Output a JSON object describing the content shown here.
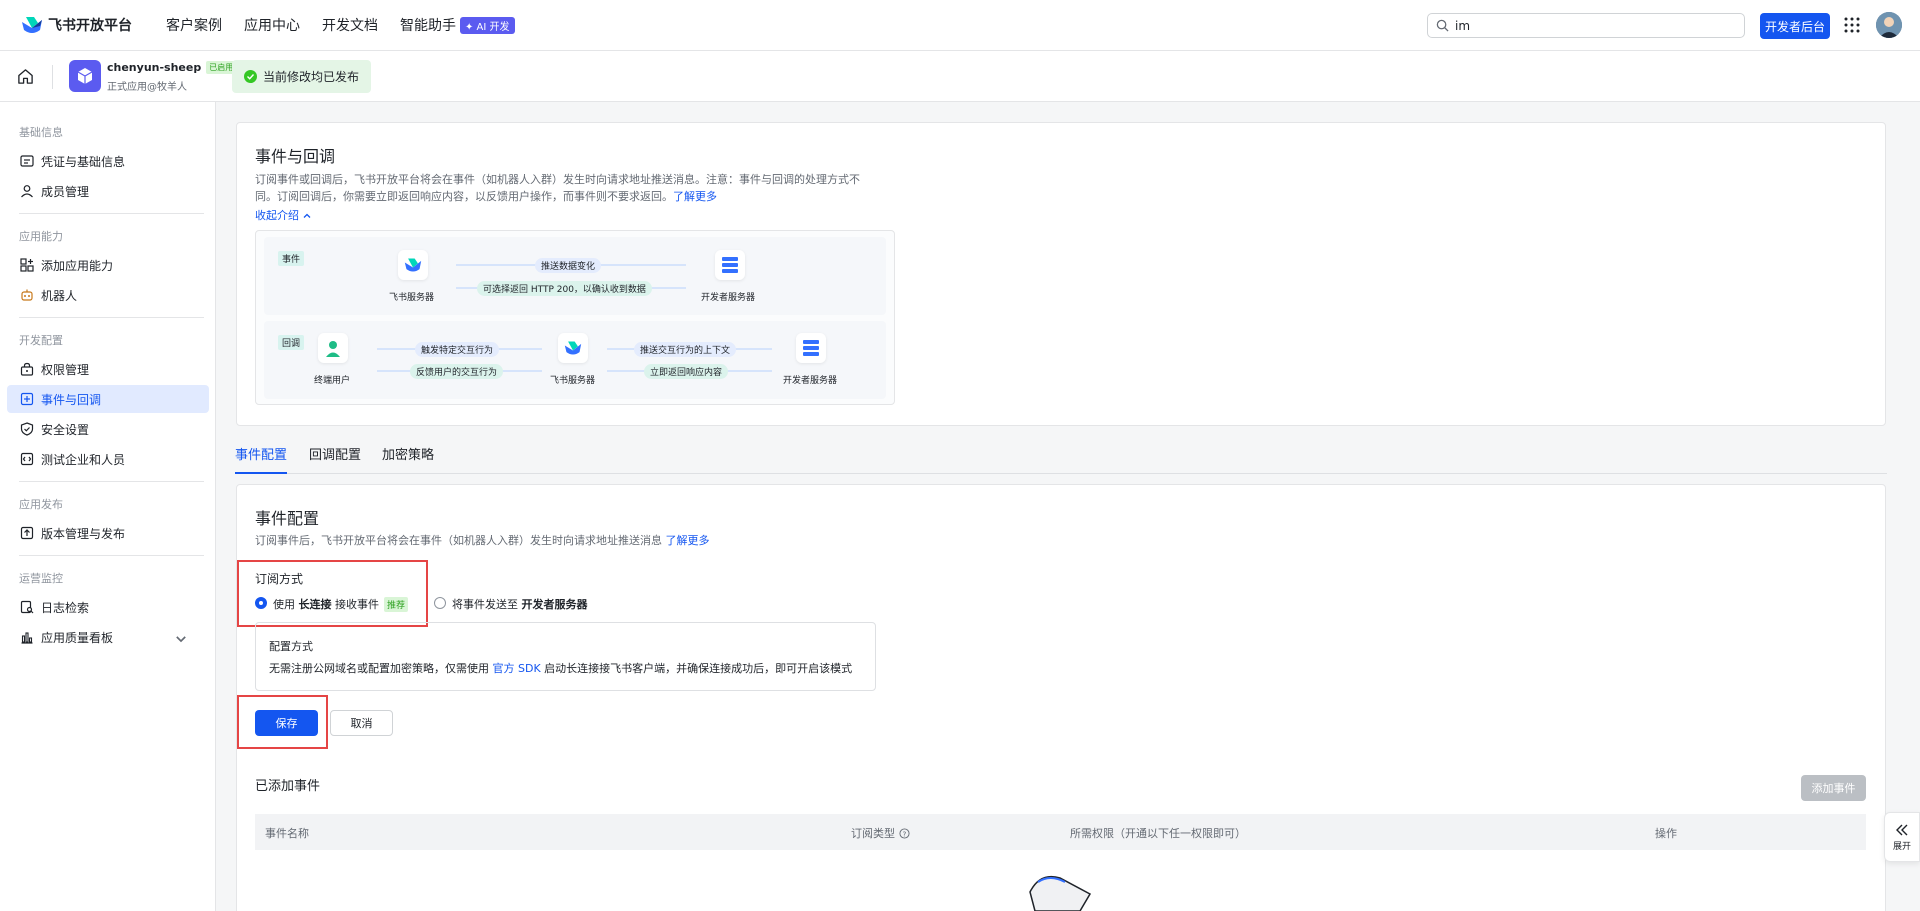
{
  "topnav": {
    "brand": "飞书开放平台",
    "links": [
      "客户案例",
      "应用中心",
      "开发文档",
      "智能助手"
    ],
    "ai_badge": "✦ AI 开发",
    "search_value": "im",
    "dev_console": "开发者后台"
  },
  "appbar": {
    "app_name": "chenyun-sheep",
    "enabled": "已启用",
    "app_sub": "正式应用@牧羊人",
    "status": "当前修改均已发布"
  },
  "sidebar": {
    "sections": [
      {
        "title": "基础信息",
        "items": [
          "凭证与基础信息",
          "成员管理"
        ]
      },
      {
        "title": "应用能力",
        "items": [
          "添加应用能力",
          "机器人"
        ]
      },
      {
        "title": "开发配置",
        "items": [
          "权限管理",
          "事件与回调",
          "安全设置",
          "测试企业和人员"
        ]
      },
      {
        "title": "应用发布",
        "items": [
          "版本管理与发布"
        ]
      },
      {
        "title": "运营监控",
        "items": [
          "日志检索",
          "应用质量看板"
        ]
      }
    ]
  },
  "intro": {
    "title": "事件与回调",
    "desc1": "订阅事件或回调后，飞书开放平台将会在事件（如机器人入群）发生时向请求地址推送消息。注意：事件与回调的处理方式不",
    "desc2": "同。订阅回调后，你需要立即返回响应内容，以反馈用户操作，而事件则不要求返回。",
    "learn_more": "了解更多",
    "collapse": "收起介绍",
    "event_tag": "事件",
    "callback_tag": "回调",
    "feishu_server": "飞书服务器",
    "dev_server": "开发者服务器",
    "end_user": "终端用户",
    "push_data": "推送数据变化",
    "http200": "可选择返回 HTTP 200，以确认收到数据",
    "trigger": "触发特定交互行为",
    "feedback": "反馈用户的交互行为",
    "push_ctx": "推送交互行为的上下文",
    "return_resp": "立即返回响应内容"
  },
  "tabs": [
    "事件配置",
    "回调配置",
    "加密策略"
  ],
  "event_config": {
    "title": "事件配置",
    "desc": "订阅事件后，飞书开放平台将会在事件（如机器人入群）发生时向请求地址推送消息",
    "learn_more": "了解更多",
    "sub_mode": "订阅方式",
    "opt1_a": "使用",
    "opt1_b": "长连接",
    "opt1_c": "接收事件",
    "recommend": "推荐",
    "opt2_a": "将事件发送至",
    "opt2_b": "开发者服务器",
    "cfg_title": "配置方式",
    "cfg_desc_a": "无需注册公网域名或配置加密策略，仅需使用",
    "cfg_link": "官方 SDK",
    "cfg_desc_b": "启动长连接接飞书客户端，并确保连接成功后，即可开启该模式",
    "save": "保存",
    "cancel": "取消",
    "added_events": "已添加事件",
    "add_event": "添加事件",
    "cols": [
      "事件名称",
      "订阅类型",
      "所需权限（开通以下任一权限即可）",
      "操作"
    ]
  },
  "expand": "展开",
  "colors": {
    "primary": "#1456f0",
    "highlight": "#e54545",
    "success": "#34c724"
  }
}
